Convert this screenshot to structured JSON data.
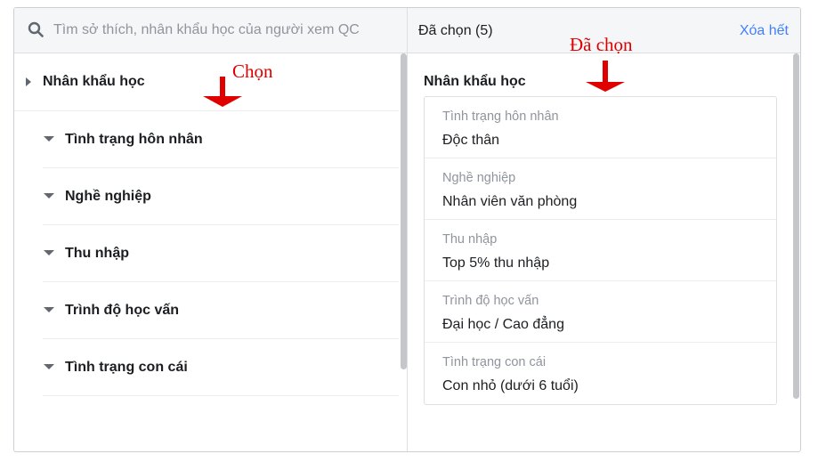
{
  "search": {
    "placeholder": "Tìm sở thích, nhân khẩu học của người xem QC"
  },
  "header": {
    "selected_count": "Đã chọn (5)",
    "clear_all": "Xóa hết"
  },
  "tree": {
    "root": "Nhân khẩu học",
    "children": [
      {
        "label": "Tình trạng hôn nhân"
      },
      {
        "label": "Nghề nghiệp"
      },
      {
        "label": "Thu nhập"
      },
      {
        "label": "Trình độ học vấn"
      },
      {
        "label": "Tình trạng con cái"
      }
    ]
  },
  "selected": {
    "title": "Nhân khẩu học",
    "items": [
      {
        "category": "Tình trạng hôn nhân",
        "value": "Độc thân"
      },
      {
        "category": "Nghề nghiệp",
        "value": "Nhân viên văn phòng"
      },
      {
        "category": "Thu nhập",
        "value": "Top 5% thu nhập"
      },
      {
        "category": "Trình độ học vấn",
        "value": "Đại học / Cao đẳng"
      },
      {
        "category": "Tình trạng con cái",
        "value": "Con nhỏ (dưới 6 tuổi)"
      }
    ]
  },
  "annotations": {
    "left": "Chọn",
    "right": "Đã chọn",
    "color": "#e00000"
  },
  "colors": {
    "link": "#4080ff",
    "header_bg": "#f5f6f7",
    "muted_text": "#90949c"
  },
  "icons": {
    "search": "search-icon",
    "expand": "caret-right-icon",
    "collapse": "caret-down-icon"
  }
}
